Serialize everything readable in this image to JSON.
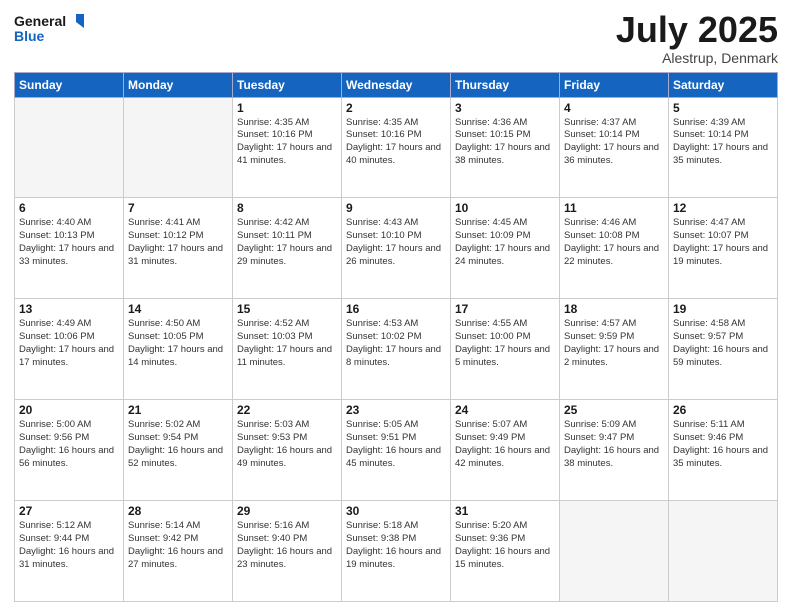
{
  "header": {
    "logo_line1": "General",
    "logo_line2": "Blue",
    "title": "July 2025",
    "location": "Alestrup, Denmark"
  },
  "days_of_week": [
    "Sunday",
    "Monday",
    "Tuesday",
    "Wednesday",
    "Thursday",
    "Friday",
    "Saturday"
  ],
  "weeks": [
    [
      {
        "day": "",
        "detail": ""
      },
      {
        "day": "",
        "detail": ""
      },
      {
        "day": "1",
        "detail": "Sunrise: 4:35 AM\nSunset: 10:16 PM\nDaylight: 17 hours\nand 41 minutes."
      },
      {
        "day": "2",
        "detail": "Sunrise: 4:35 AM\nSunset: 10:16 PM\nDaylight: 17 hours\nand 40 minutes."
      },
      {
        "day": "3",
        "detail": "Sunrise: 4:36 AM\nSunset: 10:15 PM\nDaylight: 17 hours\nand 38 minutes."
      },
      {
        "day": "4",
        "detail": "Sunrise: 4:37 AM\nSunset: 10:14 PM\nDaylight: 17 hours\nand 36 minutes."
      },
      {
        "day": "5",
        "detail": "Sunrise: 4:39 AM\nSunset: 10:14 PM\nDaylight: 17 hours\nand 35 minutes."
      }
    ],
    [
      {
        "day": "6",
        "detail": "Sunrise: 4:40 AM\nSunset: 10:13 PM\nDaylight: 17 hours\nand 33 minutes."
      },
      {
        "day": "7",
        "detail": "Sunrise: 4:41 AM\nSunset: 10:12 PM\nDaylight: 17 hours\nand 31 minutes."
      },
      {
        "day": "8",
        "detail": "Sunrise: 4:42 AM\nSunset: 10:11 PM\nDaylight: 17 hours\nand 29 minutes."
      },
      {
        "day": "9",
        "detail": "Sunrise: 4:43 AM\nSunset: 10:10 PM\nDaylight: 17 hours\nand 26 minutes."
      },
      {
        "day": "10",
        "detail": "Sunrise: 4:45 AM\nSunset: 10:09 PM\nDaylight: 17 hours\nand 24 minutes."
      },
      {
        "day": "11",
        "detail": "Sunrise: 4:46 AM\nSunset: 10:08 PM\nDaylight: 17 hours\nand 22 minutes."
      },
      {
        "day": "12",
        "detail": "Sunrise: 4:47 AM\nSunset: 10:07 PM\nDaylight: 17 hours\nand 19 minutes."
      }
    ],
    [
      {
        "day": "13",
        "detail": "Sunrise: 4:49 AM\nSunset: 10:06 PM\nDaylight: 17 hours\nand 17 minutes."
      },
      {
        "day": "14",
        "detail": "Sunrise: 4:50 AM\nSunset: 10:05 PM\nDaylight: 17 hours\nand 14 minutes."
      },
      {
        "day": "15",
        "detail": "Sunrise: 4:52 AM\nSunset: 10:03 PM\nDaylight: 17 hours\nand 11 minutes."
      },
      {
        "day": "16",
        "detail": "Sunrise: 4:53 AM\nSunset: 10:02 PM\nDaylight: 17 hours\nand 8 minutes."
      },
      {
        "day": "17",
        "detail": "Sunrise: 4:55 AM\nSunset: 10:00 PM\nDaylight: 17 hours\nand 5 minutes."
      },
      {
        "day": "18",
        "detail": "Sunrise: 4:57 AM\nSunset: 9:59 PM\nDaylight: 17 hours\nand 2 minutes."
      },
      {
        "day": "19",
        "detail": "Sunrise: 4:58 AM\nSunset: 9:57 PM\nDaylight: 16 hours\nand 59 minutes."
      }
    ],
    [
      {
        "day": "20",
        "detail": "Sunrise: 5:00 AM\nSunset: 9:56 PM\nDaylight: 16 hours\nand 56 minutes."
      },
      {
        "day": "21",
        "detail": "Sunrise: 5:02 AM\nSunset: 9:54 PM\nDaylight: 16 hours\nand 52 minutes."
      },
      {
        "day": "22",
        "detail": "Sunrise: 5:03 AM\nSunset: 9:53 PM\nDaylight: 16 hours\nand 49 minutes."
      },
      {
        "day": "23",
        "detail": "Sunrise: 5:05 AM\nSunset: 9:51 PM\nDaylight: 16 hours\nand 45 minutes."
      },
      {
        "day": "24",
        "detail": "Sunrise: 5:07 AM\nSunset: 9:49 PM\nDaylight: 16 hours\nand 42 minutes."
      },
      {
        "day": "25",
        "detail": "Sunrise: 5:09 AM\nSunset: 9:47 PM\nDaylight: 16 hours\nand 38 minutes."
      },
      {
        "day": "26",
        "detail": "Sunrise: 5:11 AM\nSunset: 9:46 PM\nDaylight: 16 hours\nand 35 minutes."
      }
    ],
    [
      {
        "day": "27",
        "detail": "Sunrise: 5:12 AM\nSunset: 9:44 PM\nDaylight: 16 hours\nand 31 minutes."
      },
      {
        "day": "28",
        "detail": "Sunrise: 5:14 AM\nSunset: 9:42 PM\nDaylight: 16 hours\nand 27 minutes."
      },
      {
        "day": "29",
        "detail": "Sunrise: 5:16 AM\nSunset: 9:40 PM\nDaylight: 16 hours\nand 23 minutes."
      },
      {
        "day": "30",
        "detail": "Sunrise: 5:18 AM\nSunset: 9:38 PM\nDaylight: 16 hours\nand 19 minutes."
      },
      {
        "day": "31",
        "detail": "Sunrise: 5:20 AM\nSunset: 9:36 PM\nDaylight: 16 hours\nand 15 minutes."
      },
      {
        "day": "",
        "detail": ""
      },
      {
        "day": "",
        "detail": ""
      }
    ]
  ]
}
